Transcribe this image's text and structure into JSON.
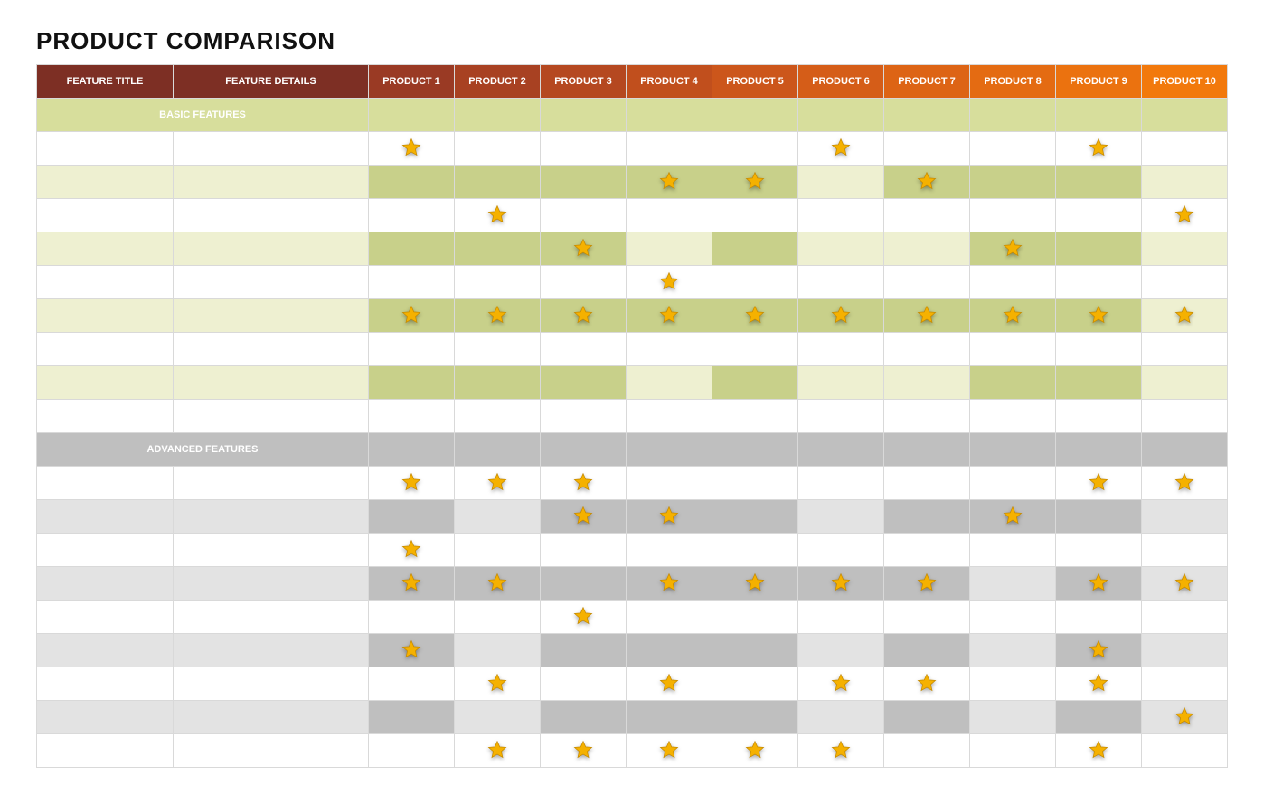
{
  "title": "PRODUCT COMPARISON",
  "headers": {
    "feature_title": "FEATURE TITLE",
    "feature_details": "FEATURE DETAILS",
    "products": [
      "PRODUCT 1",
      "PRODUCT 2",
      "PRODUCT 3",
      "PRODUCT 4",
      "PRODUCT 5",
      "PRODUCT 6",
      "PRODUCT 7",
      "PRODUCT 8",
      "PRODUCT 9",
      "PRODUCT 10"
    ]
  },
  "sections": [
    {
      "label": "BASIC FEATURES",
      "kind": "basic",
      "rows": [
        {
          "stars": [
            1,
            0,
            0,
            0,
            0,
            1,
            0,
            0,
            1,
            0
          ],
          "strong": [
            0,
            0,
            0,
            0,
            0,
            0,
            0,
            0,
            0,
            0
          ]
        },
        {
          "stars": [
            0,
            0,
            0,
            1,
            1,
            0,
            1,
            0,
            0,
            0
          ],
          "strong": [
            1,
            1,
            1,
            1,
            1,
            0,
            1,
            1,
            1,
            0
          ]
        },
        {
          "stars": [
            0,
            1,
            0,
            0,
            0,
            0,
            0,
            0,
            0,
            1
          ],
          "strong": [
            0,
            0,
            0,
            0,
            0,
            0,
            0,
            0,
            0,
            0
          ]
        },
        {
          "stars": [
            0,
            0,
            1,
            0,
            0,
            0,
            0,
            1,
            0,
            0
          ],
          "strong": [
            1,
            1,
            1,
            0,
            1,
            0,
            0,
            1,
            1,
            0
          ]
        },
        {
          "stars": [
            0,
            0,
            0,
            1,
            0,
            0,
            0,
            0,
            0,
            0
          ],
          "strong": [
            0,
            0,
            0,
            0,
            0,
            0,
            0,
            0,
            0,
            0
          ]
        },
        {
          "stars": [
            1,
            1,
            1,
            1,
            1,
            1,
            1,
            1,
            1,
            1
          ],
          "strong": [
            1,
            1,
            1,
            1,
            1,
            1,
            1,
            1,
            1,
            0
          ]
        },
        {
          "stars": [
            0,
            0,
            0,
            0,
            0,
            0,
            0,
            0,
            0,
            0
          ],
          "strong": [
            0,
            0,
            0,
            0,
            0,
            0,
            0,
            0,
            0,
            0
          ]
        },
        {
          "stars": [
            0,
            0,
            0,
            0,
            0,
            0,
            0,
            0,
            0,
            0
          ],
          "strong": [
            1,
            1,
            1,
            0,
            1,
            0,
            0,
            1,
            1,
            0
          ]
        },
        {
          "stars": [
            0,
            0,
            0,
            0,
            0,
            0,
            0,
            0,
            0,
            0
          ],
          "strong": [
            0,
            0,
            0,
            0,
            0,
            0,
            0,
            0,
            0,
            0
          ]
        }
      ]
    },
    {
      "label": "ADVANCED FEATURES",
      "kind": "adv",
      "rows": [
        {
          "stars": [
            1,
            1,
            1,
            0,
            0,
            0,
            0,
            0,
            1,
            1
          ],
          "strong": [
            0,
            0,
            0,
            0,
            0,
            0,
            0,
            0,
            0,
            0
          ]
        },
        {
          "stars": [
            0,
            0,
            1,
            1,
            0,
            0,
            0,
            1,
            0,
            0
          ],
          "strong": [
            1,
            0,
            1,
            1,
            1,
            0,
            1,
            1,
            1,
            0
          ]
        },
        {
          "stars": [
            1,
            0,
            0,
            0,
            0,
            0,
            0,
            0,
            0,
            0
          ],
          "strong": [
            0,
            0,
            0,
            0,
            0,
            0,
            0,
            0,
            0,
            0
          ]
        },
        {
          "stars": [
            1,
            1,
            0,
            1,
            1,
            1,
            1,
            0,
            1,
            1
          ],
          "strong": [
            1,
            1,
            1,
            1,
            1,
            1,
            1,
            0,
            1,
            0
          ]
        },
        {
          "stars": [
            0,
            0,
            1,
            0,
            0,
            0,
            0,
            0,
            0,
            0
          ],
          "strong": [
            0,
            0,
            0,
            0,
            0,
            0,
            0,
            0,
            0,
            0
          ]
        },
        {
          "stars": [
            1,
            0,
            0,
            0,
            0,
            0,
            0,
            0,
            1,
            0
          ],
          "strong": [
            1,
            0,
            1,
            1,
            1,
            0,
            1,
            0,
            1,
            0
          ]
        },
        {
          "stars": [
            0,
            1,
            0,
            1,
            0,
            1,
            1,
            0,
            1,
            0
          ],
          "strong": [
            0,
            0,
            0,
            0,
            0,
            0,
            0,
            0,
            0,
            0
          ]
        },
        {
          "stars": [
            0,
            0,
            0,
            0,
            0,
            0,
            0,
            0,
            0,
            1
          ],
          "strong": [
            1,
            0,
            1,
            1,
            1,
            0,
            1,
            0,
            1,
            0
          ]
        },
        {
          "stars": [
            0,
            1,
            1,
            1,
            1,
            1,
            0,
            0,
            1,
            0
          ],
          "strong": [
            0,
            0,
            0,
            0,
            0,
            0,
            0,
            0,
            0,
            0
          ]
        }
      ]
    }
  ],
  "icons": {
    "star": "star-icon"
  },
  "chart_data": {
    "type": "table",
    "title": "PRODUCT COMPARISON",
    "columns": [
      "PRODUCT 1",
      "PRODUCT 2",
      "PRODUCT 3",
      "PRODUCT 4",
      "PRODUCT 5",
      "PRODUCT 6",
      "PRODUCT 7",
      "PRODUCT 8",
      "PRODUCT 9",
      "PRODUCT 10"
    ],
    "sections": [
      {
        "name": "BASIC FEATURES",
        "matrix": [
          [
            1,
            0,
            0,
            0,
            0,
            1,
            0,
            0,
            1,
            0
          ],
          [
            0,
            0,
            0,
            1,
            1,
            0,
            1,
            0,
            0,
            0
          ],
          [
            0,
            1,
            0,
            0,
            0,
            0,
            0,
            0,
            0,
            1
          ],
          [
            0,
            0,
            1,
            0,
            0,
            0,
            0,
            1,
            0,
            0
          ],
          [
            0,
            0,
            0,
            1,
            0,
            0,
            0,
            0,
            0,
            0
          ],
          [
            1,
            1,
            1,
            1,
            1,
            1,
            1,
            1,
            1,
            1
          ],
          [
            0,
            0,
            0,
            0,
            0,
            0,
            0,
            0,
            0,
            0
          ],
          [
            0,
            0,
            0,
            0,
            0,
            0,
            0,
            0,
            0,
            0
          ],
          [
            0,
            0,
            0,
            0,
            0,
            0,
            0,
            0,
            0,
            0
          ]
        ]
      },
      {
        "name": "ADVANCED FEATURES",
        "matrix": [
          [
            1,
            1,
            1,
            0,
            0,
            0,
            0,
            0,
            1,
            1
          ],
          [
            0,
            0,
            1,
            1,
            0,
            0,
            0,
            1,
            0,
            0
          ],
          [
            1,
            0,
            0,
            0,
            0,
            0,
            0,
            0,
            0,
            0
          ],
          [
            1,
            1,
            0,
            1,
            1,
            1,
            1,
            0,
            1,
            1
          ],
          [
            0,
            0,
            1,
            0,
            0,
            0,
            0,
            0,
            0,
            0
          ],
          [
            1,
            0,
            0,
            0,
            0,
            0,
            0,
            0,
            1,
            0
          ],
          [
            0,
            1,
            0,
            1,
            0,
            1,
            1,
            0,
            1,
            0
          ],
          [
            0,
            0,
            0,
            0,
            0,
            0,
            0,
            0,
            0,
            1
          ],
          [
            0,
            1,
            1,
            1,
            1,
            1,
            0,
            0,
            1,
            0
          ]
        ]
      }
    ]
  }
}
